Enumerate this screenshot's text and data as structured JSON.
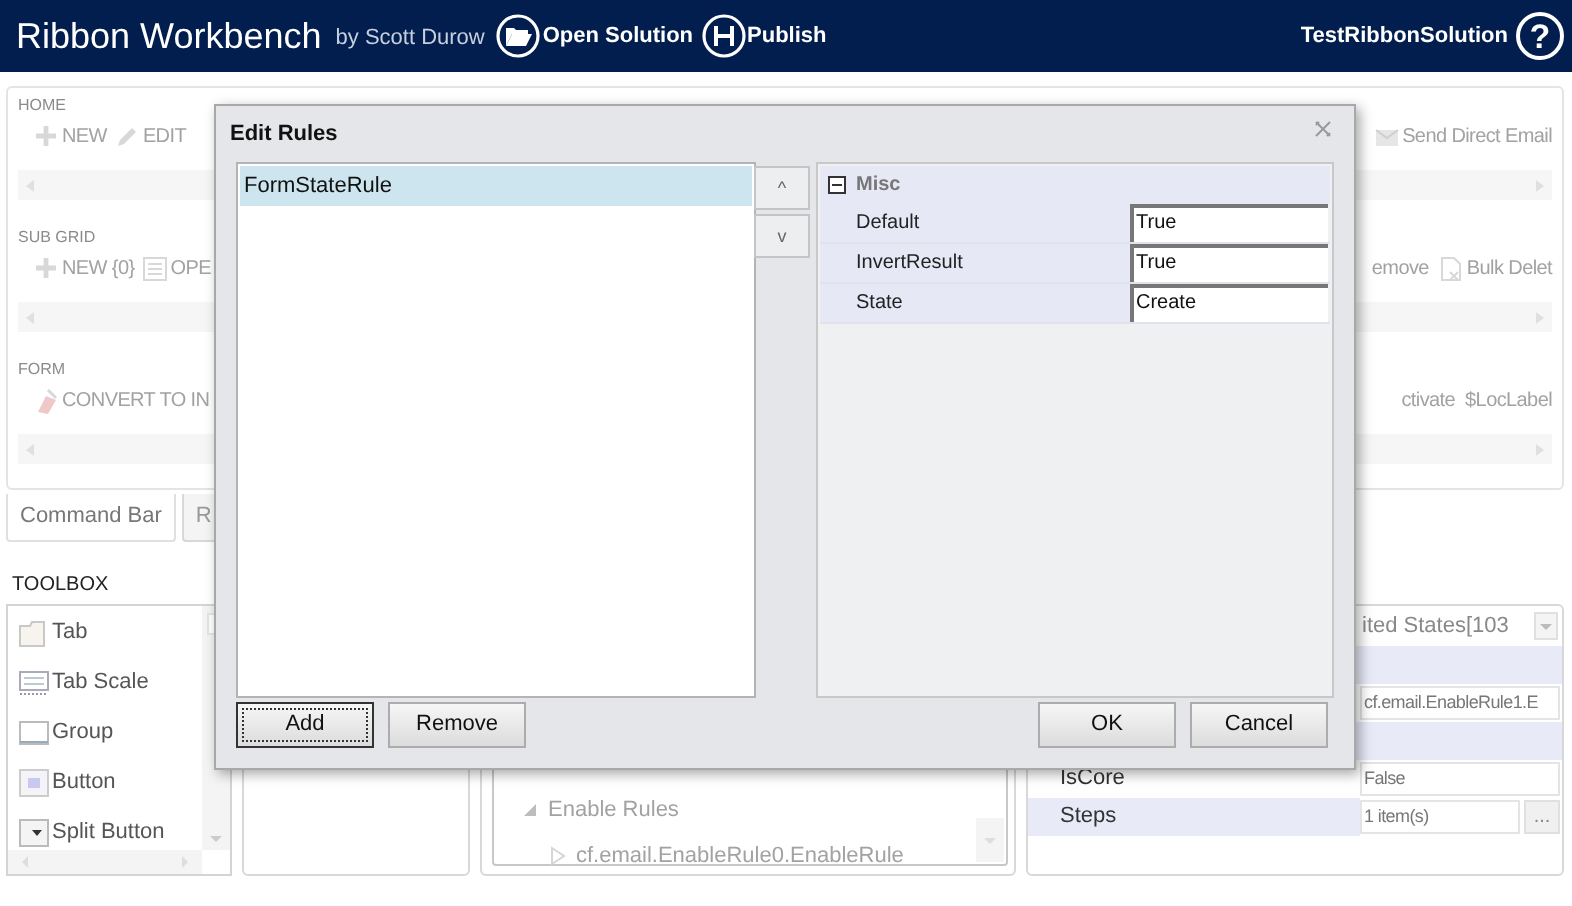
{
  "header": {
    "title": "Ribbon Workbench",
    "byline": "by Scott Durow",
    "actions": [
      {
        "kind": "open",
        "label": "Open Solution"
      },
      {
        "kind": "publish",
        "label": "Publish"
      }
    ],
    "solution": "TestRibbonSolution",
    "help": "?"
  },
  "ribbon": {
    "sections": [
      {
        "label": "HOME",
        "left": [
          {
            "kind": "plus",
            "label": "NEW"
          },
          {
            "kind": "pencil",
            "label": "EDIT"
          }
        ],
        "right": [
          {
            "kind": "mail",
            "label": "Send Direct Email"
          }
        ]
      },
      {
        "label": "SUB GRID",
        "left": [
          {
            "kind": "plus",
            "label": "NEW {0}"
          },
          {
            "kind": "grid",
            "label": "OPE"
          }
        ],
        "right": [
          {
            "kind": "none",
            "label": "emove"
          },
          {
            "kind": "doc",
            "label": "Bulk Delet"
          }
        ]
      },
      {
        "label": "FORM",
        "left": [
          {
            "kind": "convert",
            "label": "CONVERT TO IN"
          }
        ],
        "right": [
          {
            "kind": "none",
            "label": "ctivate"
          },
          {
            "kind": "none",
            "label": "$LocLabel"
          }
        ]
      }
    ]
  },
  "tabs": [
    {
      "label": "Command Bar",
      "selected": true
    },
    {
      "label": "R",
      "selected": false
    }
  ],
  "toolbox": {
    "title": "TOOLBOX",
    "items": [
      {
        "kind": "tab",
        "label": "Tab"
      },
      {
        "kind": "scale",
        "label": "Tab Scale"
      },
      {
        "kind": "group",
        "label": "Group"
      },
      {
        "kind": "button",
        "label": "Button"
      },
      {
        "kind": "split",
        "label": "Split Button"
      }
    ]
  },
  "tree": {
    "nodes": [
      {
        "label": "Enable Rules",
        "expanded": true,
        "children": [
          {
            "label": "cf.email.EnableRule0.EnableRule",
            "expanded": false
          }
        ]
      }
    ]
  },
  "properties": {
    "dropdown": "ited States[103",
    "rows": [
      {
        "kind": "band"
      },
      {
        "kind": "field",
        "value": "cf.email.EnableRule1.E"
      },
      {
        "kind": "band"
      },
      {
        "kind": "field",
        "label": "IsCore",
        "value": "False"
      },
      {
        "kind": "ellipsis",
        "label": "Steps",
        "value": "1 item(s)",
        "button": "..."
      }
    ]
  },
  "dialog": {
    "title": "Edit Rules",
    "rules": [
      {
        "label": "FormStateRule",
        "selected": true
      }
    ],
    "move_buttons": [
      "^",
      "v"
    ],
    "grid": {
      "category": "Misc",
      "expanded": true,
      "rows": [
        {
          "label": "Default",
          "value": "True"
        },
        {
          "label": "InvertResult",
          "value": "True"
        },
        {
          "label": "State",
          "value": "Create"
        }
      ]
    },
    "left_buttons": [
      {
        "label": "Add",
        "focused": true
      },
      {
        "label": "Remove",
        "focused": false
      }
    ],
    "right_buttons": [
      {
        "label": "OK",
        "focused": false
      },
      {
        "label": "Cancel",
        "focused": false
      }
    ]
  }
}
